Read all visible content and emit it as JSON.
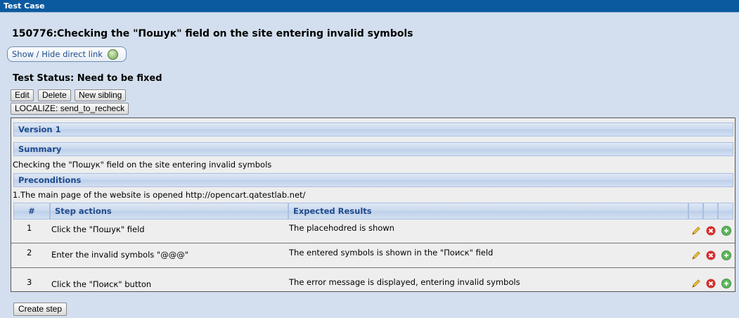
{
  "window": {
    "title": "Test Case"
  },
  "test_case": {
    "title": "150776:Checking the \"Пошук\" field on the site entering invalid symbols",
    "direct_link_label": "Show / Hide direct link",
    "status": "Test Status: Need to be fixed"
  },
  "actions": {
    "edit": "Edit",
    "delete": "Delete",
    "new_sibling": "New sibling",
    "localize": "LOCALIZE: send_to_recheck"
  },
  "version": {
    "label": "Version 1",
    "summary_header": "Summary",
    "summary_text": "Checking the \"Пошук\" field on the site entering invalid symbols",
    "preconditions_header": "Preconditions",
    "preconditions_text": "1.The main page of the website is opened http://opencart.qatestlab.net/"
  },
  "steps_table": {
    "columns": [
      "#",
      "Step actions",
      "Expected Results"
    ],
    "rows": [
      {
        "num": "1",
        "action": "Click the \"Пошук\" field",
        "expected": "The placehodred is shown"
      },
      {
        "num": "2",
        "action": "Enter the invalid symbols \"@@@\"",
        "expected": "The entered symbols is shown in the \"Поиск\" field"
      },
      {
        "num": "3",
        "action": "Click the \"Поиск\" button",
        "expected": "The error message is displayed, entering invalid symbols"
      }
    ]
  },
  "footer": {
    "create_step": "Create step"
  },
  "icons": {
    "edit": "pencil-icon",
    "delete": "red-x-icon",
    "add": "green-plus-icon"
  },
  "colors": {
    "titlebar": "#0b5aa0",
    "section_text": "#1e4a8c",
    "background": "#d3dfee"
  }
}
